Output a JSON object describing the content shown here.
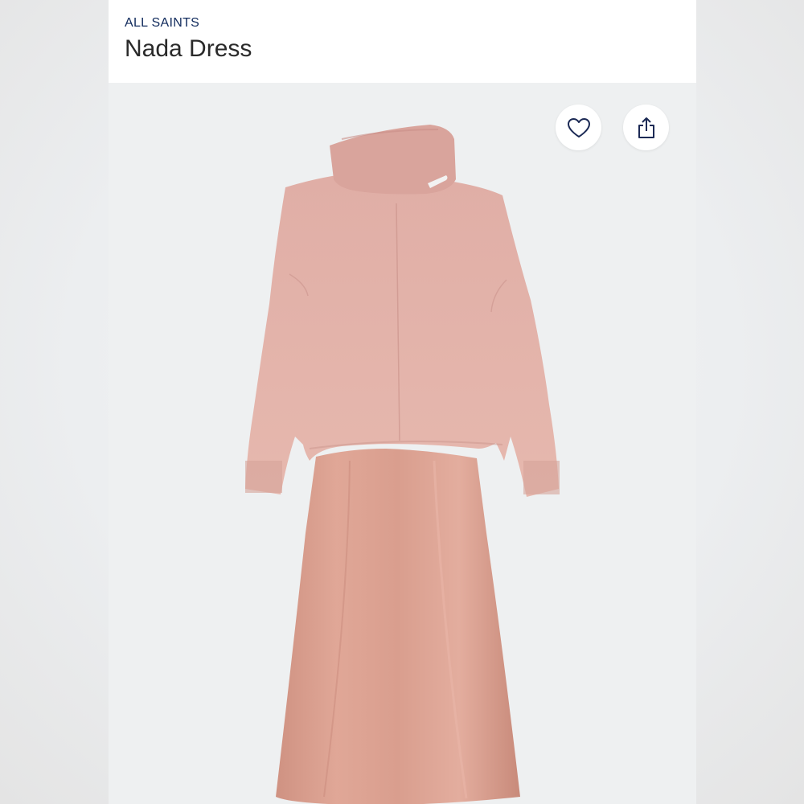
{
  "header": {
    "brand": "ALL SAINTS",
    "title": "Nada Dress"
  },
  "actions": {
    "favorite_icon": "heart-icon",
    "share_icon": "share-icon"
  },
  "product_image": {
    "alt": "Pink turtleneck sweater layered over satin slip dress"
  },
  "colors": {
    "brand_text": "#102a5c",
    "sweater": "#e2b3aa",
    "skirt": "#d79c8c"
  }
}
